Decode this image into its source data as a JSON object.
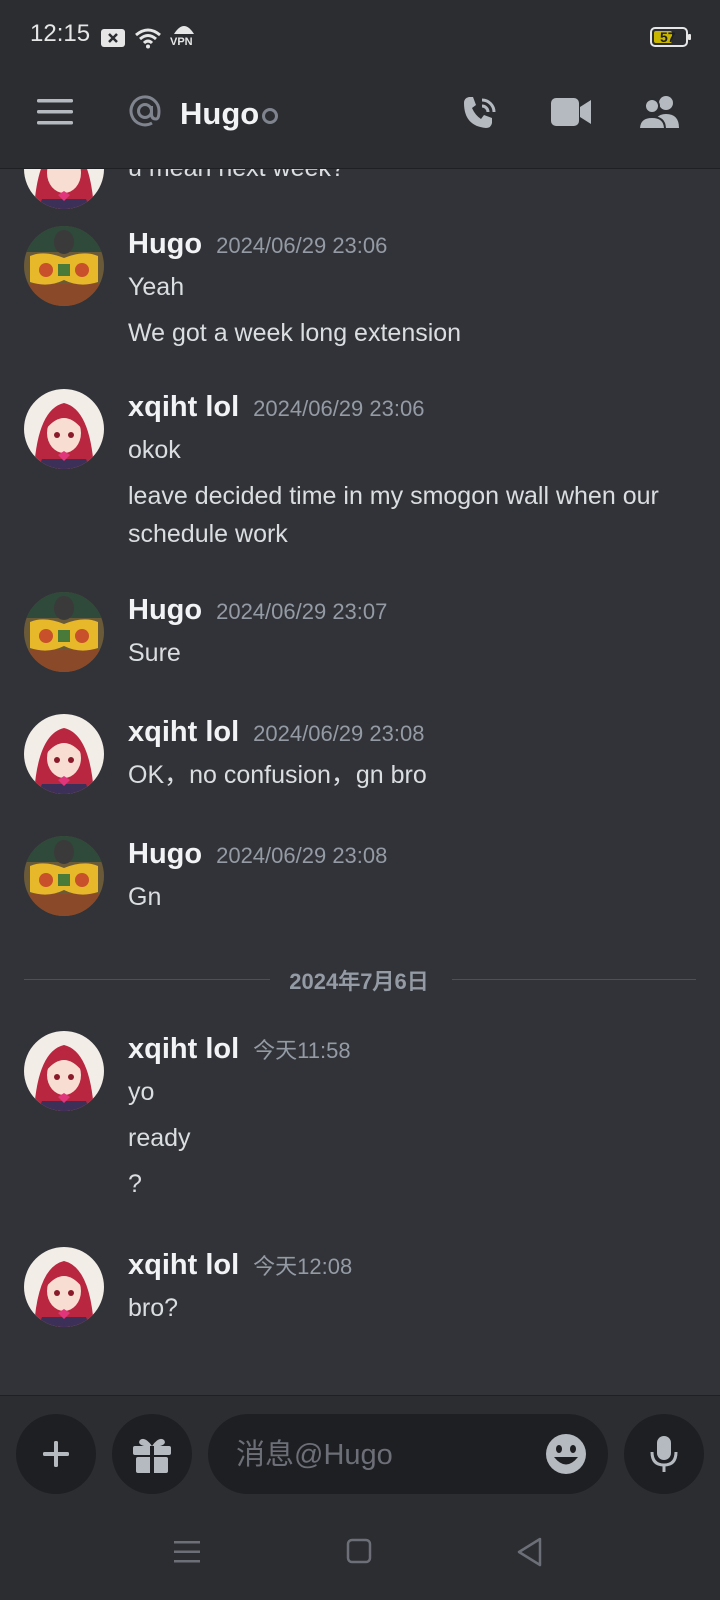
{
  "status": {
    "time": "12:15",
    "battery": "57",
    "vpn": "VPN"
  },
  "header": {
    "title": "Hugo"
  },
  "messages": [
    {
      "user": "",
      "time": "",
      "lines": [
        "u mean next week?"
      ]
    },
    {
      "user": "Hugo",
      "time": "2024/06/29 23:06",
      "lines": [
        "Yeah",
        "We got a week long extension"
      ]
    },
    {
      "user": "xqiht lol",
      "time": "2024/06/29 23:06",
      "lines": [
        "okok",
        "leave decided time in my smogon wall when our",
        "schedule work"
      ]
    },
    {
      "user": "Hugo",
      "time": "2024/06/29 23:07",
      "lines": [
        "Sure"
      ]
    },
    {
      "user": "xqiht lol",
      "time": "2024/06/29 23:08",
      "lines": [
        "OK，no confusion，gn bro"
      ]
    },
    {
      "user": "Hugo",
      "time": "2024/06/29 23:08",
      "lines": [
        "Gn"
      ]
    },
    {
      "user": "xqiht lol",
      "time": "今天11:58",
      "lines": [
        "yo",
        "ready",
        "?"
      ]
    },
    {
      "user": "xqiht lol",
      "time": "今天12:08",
      "lines": [
        "bro?"
      ]
    }
  ],
  "divider": {
    "label": "2024年7月6日"
  },
  "composer": {
    "placeholder": "消息@Hugo"
  },
  "colors": {
    "background": "#313338",
    "header": "#2b2d31",
    "input": "#1e1f22"
  }
}
